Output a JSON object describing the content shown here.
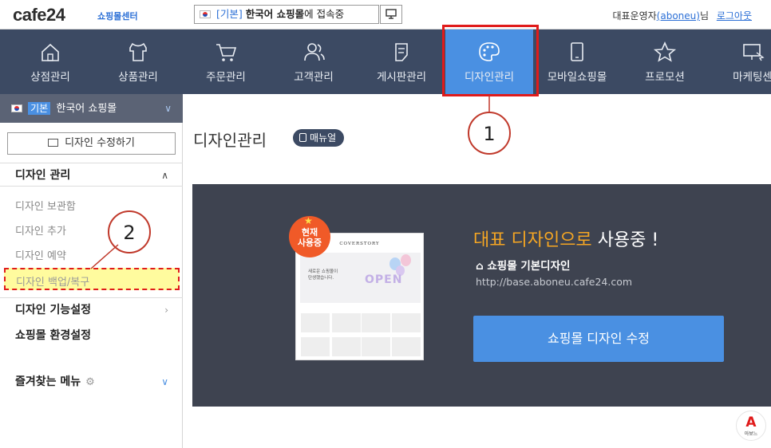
{
  "topbar": {
    "logo": "cafe24",
    "logo_sub": "쇼핑몰센터",
    "shop_select": {
      "tag": "[기본]",
      "name": "한국어 쇼핑몰",
      "suffix": "에 접속중"
    },
    "user_label": "대표운영자",
    "user_id": "(aboneu)",
    "user_suffix": "님",
    "logout": "로그아웃"
  },
  "nav": {
    "items": [
      {
        "label": "상점관리",
        "icon": "home-icon"
      },
      {
        "label": "상품관리",
        "icon": "shirt-icon"
      },
      {
        "label": "주문관리",
        "icon": "cart-icon"
      },
      {
        "label": "고객관리",
        "icon": "users-icon"
      },
      {
        "label": "게시판관리",
        "icon": "board-icon"
      },
      {
        "label": "디자인관리",
        "icon": "palette-icon",
        "active": true
      },
      {
        "label": "모바일쇼핑몰",
        "icon": "mobile-icon"
      },
      {
        "label": "프로모션",
        "icon": "star-icon"
      },
      {
        "label": "마케팅센",
        "icon": "marketing-icon"
      }
    ]
  },
  "sidebar": {
    "shop": {
      "basic": "기본",
      "name": "한국어 쇼핑몰"
    },
    "edit_button": "디자인 수정하기",
    "section_design": "디자인 관리",
    "links": [
      "디자인 보관함",
      "디자인 추가",
      "디자인 예약",
      "디자인 백업/복구"
    ],
    "section_function": "디자인 기능설정",
    "section_env": "쇼핑몰 환경설정",
    "section_fav": "즐겨찾는 메뉴"
  },
  "annotations": {
    "circle_1": "1",
    "circle_2": "2",
    "highlight_color": "#e01b1b"
  },
  "content": {
    "title": "디자인관리",
    "manual": "매뉴얼",
    "badge": [
      "현재",
      "사용중"
    ],
    "thumb_title": "COVERSTORY",
    "thumb_hero_text": [
      "새로운 쇼핑몰이",
      "탄생했습니다."
    ],
    "thumb_open": "OPEN",
    "using_highlight": "대표 디자인으로",
    "using_rest": "사용중 !",
    "base_design": "쇼핑몰 기본디자인",
    "url": "http://base.aboneu.cafe24.com",
    "edit_button": "쇼핑몰 디자인 수정"
  },
  "corner_logo": {
    "mark": "A",
    "text": "아보느"
  },
  "colors": {
    "nav_bg": "#3c4a63",
    "accent": "#4a90e2",
    "panel_bg": "#3e4350",
    "highlight_yellow": "#f5a623"
  }
}
